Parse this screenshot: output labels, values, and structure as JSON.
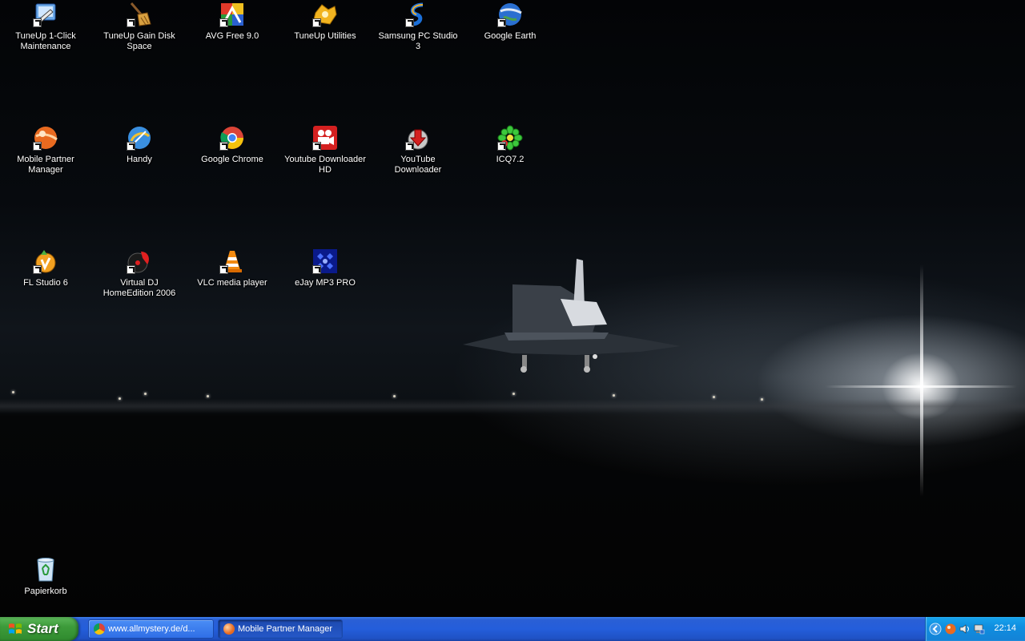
{
  "desktop": {
    "icons": [
      {
        "label": "TuneUp 1-Click Maintenance",
        "icon": "tuneup-maintenance-icon"
      },
      {
        "label": "TuneUp Gain Disk Space",
        "icon": "broom-icon"
      },
      {
        "label": "AVG Free 9.0",
        "icon": "avg-icon"
      },
      {
        "label": "TuneUp Utilities",
        "icon": "tuneup-utilities-icon"
      },
      {
        "label": "Samsung PC Studio 3",
        "icon": "samsung-pc-studio-icon"
      },
      {
        "label": "Google Earth",
        "icon": "globe-icon"
      },
      {
        "label": "Mobile Partner Manager",
        "icon": "mobile-partner-icon"
      },
      {
        "label": "Handy",
        "icon": "handy-icon"
      },
      {
        "label": "Google Chrome",
        "icon": "chrome-icon"
      },
      {
        "label": "Youtube Downloader HD",
        "icon": "film-camera-icon"
      },
      {
        "label": "YouTube Downloader",
        "icon": "download-arrow-icon"
      },
      {
        "label": "ICQ7.2",
        "icon": "icq-flower-icon"
      },
      {
        "label": "FL Studio 6",
        "icon": "fl-studio-icon"
      },
      {
        "label": "Virtual DJ HomeEdition 2006",
        "icon": "vinyl-icon"
      },
      {
        "label": "VLC media player",
        "icon": "traffic-cone-icon"
      },
      {
        "label": "eJay MP3 PRO",
        "icon": "ejay-icon"
      }
    ],
    "recycle_bin": {
      "label": "Papierkorb",
      "icon": "recycle-bin-icon"
    }
  },
  "taskbar": {
    "start_label": "Start",
    "tasks": [
      {
        "label": "www.allmystery.de/d...",
        "icon": "chrome-icon"
      },
      {
        "label": "Mobile Partner Manager",
        "icon": "mobile-partner-icon"
      }
    ],
    "tray": {
      "icons": [
        "chevron-left-icon",
        "mobile-partner-icon",
        "speaker-icon",
        "network-icon"
      ],
      "clock": "22:14"
    }
  },
  "colors": {
    "taskbar": "#245edb",
    "start_button": "#3d9b3a",
    "tray": "#0f8ee0"
  }
}
